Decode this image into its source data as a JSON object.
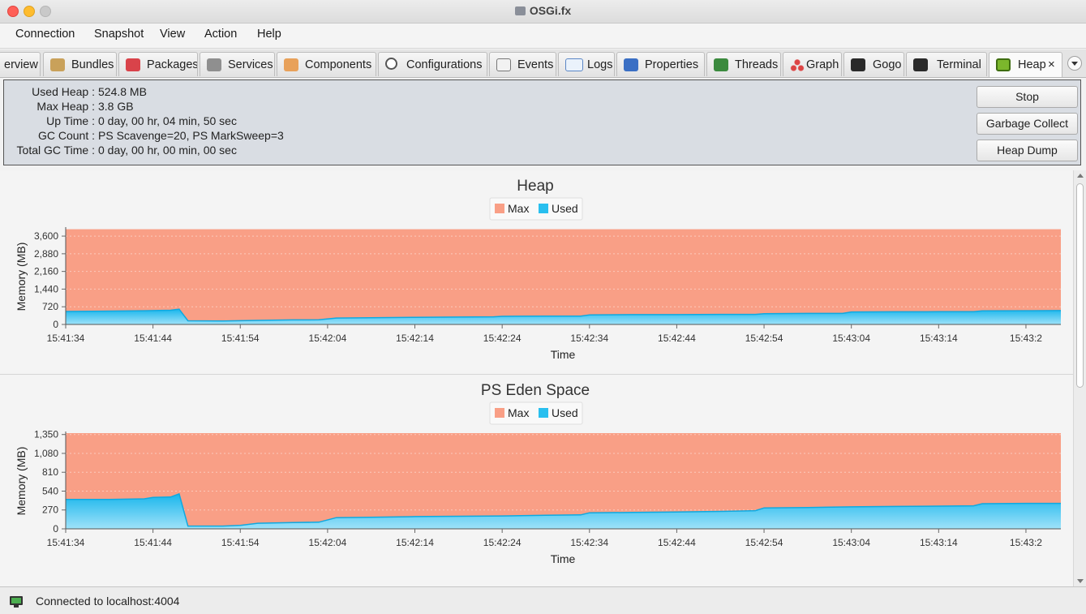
{
  "window": {
    "title": "OSGi.fx"
  },
  "menu": [
    "Connection",
    "Snapshot",
    "View",
    "Action",
    "Help"
  ],
  "tabs": [
    {
      "label": "erview",
      "icon": "overview-icon"
    },
    {
      "label": "Bundles",
      "icon": "bundles-icon"
    },
    {
      "label": "Packages",
      "icon": "packages-icon"
    },
    {
      "label": "Services",
      "icon": "services-icon"
    },
    {
      "label": "Components",
      "icon": "components-icon"
    },
    {
      "label": "Configurations",
      "icon": "gear-icon"
    },
    {
      "label": "Events",
      "icon": "events-icon"
    },
    {
      "label": "Logs",
      "icon": "logs-icon"
    },
    {
      "label": "Properties",
      "icon": "properties-icon"
    },
    {
      "label": "Threads",
      "icon": "threads-icon"
    },
    {
      "label": "Graph",
      "icon": "graph-icon"
    },
    {
      "label": "Gogo",
      "icon": "console-icon"
    },
    {
      "label": "Terminal",
      "icon": "terminal-icon"
    },
    {
      "label": "Heap",
      "icon": "chip-icon",
      "active": true,
      "close": "×"
    }
  ],
  "info": {
    "rows": [
      {
        "label": "Used Heap :",
        "value": "524.8 MB"
      },
      {
        "label": "Max Heap :",
        "value": "3.8 GB"
      },
      {
        "label": "Up Time :",
        "value": "0 day, 00 hr, 04 min, 50 sec"
      },
      {
        "label": "GC Count :",
        "value": "PS Scavenge=20, PS MarkSweep=3"
      },
      {
        "label": "Total GC Time :",
        "value": "0 day, 00 hr, 00 min, 00 sec"
      }
    ],
    "buttons": {
      "stop": "Stop",
      "gc": "Garbage Collect",
      "dump": "Heap Dump"
    }
  },
  "status": {
    "text": "Connected to localhost:4004"
  },
  "colors": {
    "max": "#f99f86",
    "used": "#29bfef"
  },
  "chart_data": [
    {
      "type": "area",
      "title": "Heap",
      "xlabel": "Time",
      "ylabel": "Memory (MB)",
      "legend": [
        "Max",
        "Used"
      ],
      "legend_position": "top-center",
      "xticks": [
        "15:41:34",
        "15:41:44",
        "15:41:54",
        "15:42:04",
        "15:42:14",
        "15:42:24",
        "15:42:34",
        "15:42:44",
        "15:42:54",
        "15:43:04",
        "15:43:14",
        "15:43:2"
      ],
      "yticks": [
        "0",
        "720",
        "1,440",
        "2,160",
        "2,880",
        "3,600"
      ],
      "ylim": [
        0,
        3900
      ],
      "xlim": [
        0,
        114
      ],
      "max_value": 3880,
      "used": [
        [
          0,
          530
        ],
        [
          9,
          560
        ],
        [
          12,
          580
        ],
        [
          13,
          620
        ],
        [
          14,
          150
        ],
        [
          18,
          140
        ],
        [
          22,
          165
        ],
        [
          26,
          185
        ],
        [
          29,
          190
        ],
        [
          31,
          260
        ],
        [
          35,
          270
        ],
        [
          40,
          290
        ],
        [
          45,
          300
        ],
        [
          49,
          310
        ],
        [
          50,
          330
        ],
        [
          55,
          340
        ],
        [
          59,
          340
        ],
        [
          60,
          390
        ],
        [
          65,
          400
        ],
        [
          70,
          400
        ],
        [
          75,
          410
        ],
        [
          79,
          410
        ],
        [
          80,
          440
        ],
        [
          85,
          450
        ],
        [
          89,
          450
        ],
        [
          90,
          510
        ],
        [
          95,
          515
        ],
        [
          100,
          520
        ],
        [
          104,
          520
        ],
        [
          105,
          555
        ],
        [
          110,
          560
        ],
        [
          114,
          565
        ]
      ]
    },
    {
      "type": "area",
      "title": "PS Eden Space",
      "xlabel": "Time",
      "ylabel": "Memory (MB)",
      "legend": [
        "Max",
        "Used"
      ],
      "legend_position": "top-center",
      "xticks": [
        "15:41:34",
        "15:41:44",
        "15:41:54",
        "15:42:04",
        "15:42:14",
        "15:42:24",
        "15:42:34",
        "15:42:44",
        "15:42:54",
        "15:43:04",
        "15:43:14",
        "15:43:2"
      ],
      "yticks": [
        "0",
        "270",
        "540",
        "810",
        "1,080",
        "1,350"
      ],
      "ylim": [
        0,
        1370
      ],
      "xlim": [
        0,
        114
      ],
      "max_value": 1370,
      "used": [
        [
          0,
          420
        ],
        [
          5,
          420
        ],
        [
          9,
          430
        ],
        [
          10,
          450
        ],
        [
          12,
          455
        ],
        [
          13,
          500
        ],
        [
          14,
          40
        ],
        [
          18,
          40
        ],
        [
          20,
          50
        ],
        [
          22,
          80
        ],
        [
          26,
          90
        ],
        [
          29,
          95
        ],
        [
          31,
          160
        ],
        [
          35,
          165
        ],
        [
          40,
          175
        ],
        [
          45,
          180
        ],
        [
          50,
          185
        ],
        [
          55,
          195
        ],
        [
          59,
          200
        ],
        [
          60,
          230
        ],
        [
          65,
          235
        ],
        [
          70,
          240
        ],
        [
          75,
          250
        ],
        [
          79,
          260
        ],
        [
          80,
          300
        ],
        [
          85,
          305
        ],
        [
          90,
          315
        ],
        [
          95,
          320
        ],
        [
          100,
          325
        ],
        [
          104,
          330
        ],
        [
          105,
          360
        ],
        [
          110,
          365
        ],
        [
          114,
          365
        ],
        [
          114,
          365
        ]
      ]
    }
  ]
}
